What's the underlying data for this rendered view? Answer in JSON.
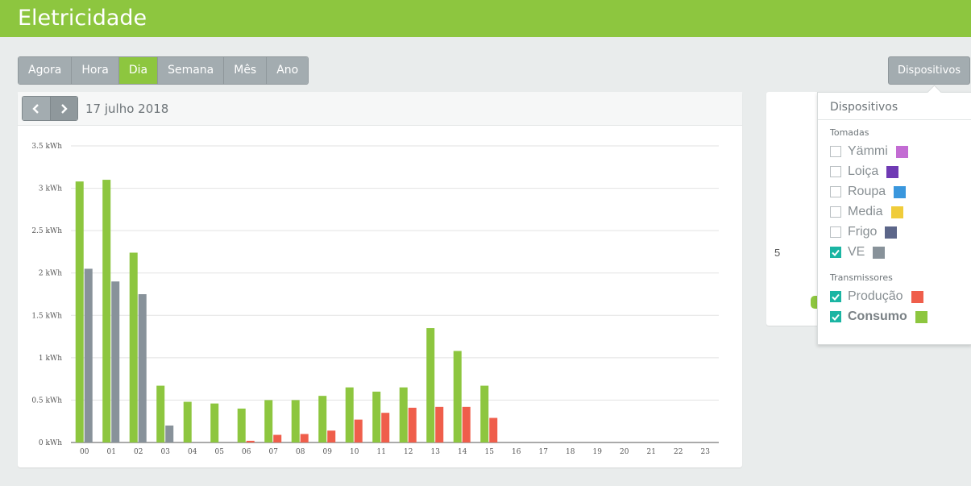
{
  "header": {
    "title": "Eletricidade"
  },
  "period_tabs": [
    {
      "label": "Agora",
      "active": false
    },
    {
      "label": "Hora",
      "active": false
    },
    {
      "label": "Dia",
      "active": true
    },
    {
      "label": "Semana",
      "active": false
    },
    {
      "label": "Mês",
      "active": false
    },
    {
      "label": "Ano",
      "active": false
    }
  ],
  "devices_button": {
    "label": "Dispositivos"
  },
  "date_nav": {
    "date": "17 julho 2018",
    "prev_icon": "chevron-left-icon",
    "next_icon": "chevron-right-icon"
  },
  "side_panel": {
    "partial_text": "5"
  },
  "dropdown": {
    "title": "Dispositivos",
    "tomadas_label": "Tomadas",
    "tomadas": [
      {
        "label": "Yämmi",
        "checked": false,
        "color": "#c36cd3"
      },
      {
        "label": "Loiça",
        "checked": false,
        "color": "#6f3ab4"
      },
      {
        "label": "Roupa",
        "checked": false,
        "color": "#3a97dd"
      },
      {
        "label": "Media",
        "checked": false,
        "color": "#f0cc3a"
      },
      {
        "label": "Frigo",
        "checked": false,
        "color": "#5c6689"
      },
      {
        "label": "VE",
        "checked": true,
        "color": "#88929a"
      }
    ],
    "transmissores_label": "Transmissores",
    "transmissores": [
      {
        "label": "Produção",
        "checked": true,
        "color": "#ef5e4b",
        "bold": false
      },
      {
        "label": "Consumo",
        "checked": true,
        "color": "#8dc63f",
        "bold": true
      }
    ]
  },
  "chart_data": {
    "type": "bar",
    "categories": [
      "00",
      "01",
      "02",
      "03",
      "04",
      "05",
      "06",
      "07",
      "08",
      "09",
      "10",
      "11",
      "12",
      "13",
      "14",
      "15",
      "16",
      "17",
      "18",
      "19",
      "20",
      "21",
      "22",
      "23"
    ],
    "y_ticks": [
      "0 kWh",
      "0.5 kWh",
      "1 kWh",
      "1.5 kWh",
      "2 kWh",
      "2.5 kWh",
      "3 kWh",
      "3.5 kWh"
    ],
    "ylim": [
      0,
      3.5
    ],
    "series": [
      {
        "name": "Consumo",
        "color": "#8dc63f",
        "values": [
          3.08,
          3.1,
          2.24,
          0.67,
          0.48,
          0.46,
          0.4,
          0.5,
          0.5,
          0.55,
          0.65,
          0.6,
          0.65,
          1.35,
          1.08,
          0.67,
          null,
          null,
          null,
          null,
          null,
          null,
          null,
          null
        ]
      },
      {
        "name": "VE",
        "color": "#88929a",
        "values": [
          2.05,
          1.9,
          1.75,
          0.2,
          null,
          null,
          null,
          null,
          null,
          null,
          null,
          null,
          null,
          null,
          null,
          null,
          null,
          null,
          null,
          null,
          null,
          null,
          null,
          null
        ]
      },
      {
        "name": "Produção",
        "color": "#ef5e4b",
        "values": [
          null,
          null,
          null,
          null,
          null,
          null,
          0.02,
          0.09,
          0.1,
          0.14,
          0.27,
          0.35,
          0.41,
          0.42,
          0.42,
          0.29,
          null,
          null,
          null,
          null,
          null,
          null,
          null,
          null
        ]
      }
    ]
  }
}
